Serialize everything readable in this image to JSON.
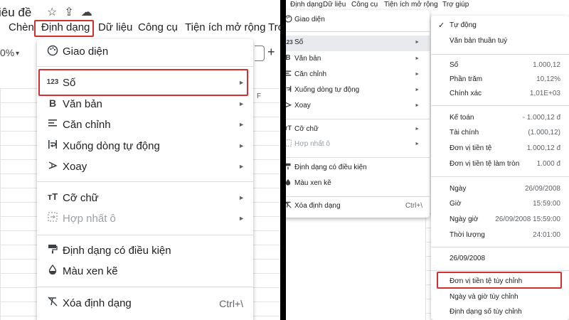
{
  "left": {
    "doc_title": "iêu đề",
    "toolbar_icons": {
      "star": "☆",
      "folder": "⇪",
      "cloud": "☁"
    },
    "menubar": [
      {
        "label": "Chèn"
      },
      {
        "label": "Định dạng"
      },
      {
        "label": "Dữ liệu"
      },
      {
        "label": "Công cụ"
      },
      {
        "label": "Tiện ích mở rộng"
      },
      {
        "label": "Trợ"
      }
    ],
    "zoom": "0%",
    "zoom_arrow": "▾",
    "plus": "+",
    "column_f": "F",
    "menu": {
      "theme": {
        "label": "Giao diện",
        "icon": "palette-icon"
      },
      "number": {
        "label": "Số",
        "icon": "123",
        "arrow": "►"
      },
      "text": {
        "label": "Văn bản",
        "icon": "B",
        "arrow": "►"
      },
      "align": {
        "label": "Căn chỉnh",
        "icon": "align-icon",
        "arrow": "►"
      },
      "wrap": {
        "label": "Xuống dòng tự động",
        "icon": "wrap-icon",
        "arrow": "►"
      },
      "rotate": {
        "label": "Xoay",
        "icon": "rotate-icon",
        "arrow": "►"
      },
      "fontsize": {
        "label": "Cỡ chữ",
        "icon": "тT",
        "arrow": "►"
      },
      "merge": {
        "label": "Hợp nhất ô",
        "icon": "merge-icon",
        "arrow": "►"
      },
      "conditional": {
        "label": "Định dạng có điều kiện",
        "icon": "paint-roller-icon"
      },
      "alternating": {
        "label": "Màu xen kẽ",
        "icon": "droplet-icon"
      },
      "clear": {
        "label": "Xóa định dạng",
        "icon": "clear-format-icon",
        "shortcut": "Ctrl+\\"
      }
    }
  },
  "right": {
    "menubar": [
      {
        "label": "Định dạng"
      },
      {
        "label": "Dữ liệu"
      },
      {
        "label": "Công cụ"
      },
      {
        "label": "Tiện ích mở rộng"
      },
      {
        "label": "Trợ giúp"
      }
    ],
    "menu": {
      "theme": {
        "label": "Giao diện"
      },
      "number": {
        "label": "Số",
        "icon": "123",
        "arrow": "►"
      },
      "text": {
        "label": "Văn bản",
        "icon": "B",
        "arrow": "►"
      },
      "align": {
        "label": "Căn chỉnh",
        "arrow": "►"
      },
      "wrap": {
        "label": "Xuống dòng tự động",
        "arrow": "►"
      },
      "rotate": {
        "label": "Xoay",
        "arrow": "►"
      },
      "fontsize": {
        "label": "Cỡ chữ",
        "icon": "тT",
        "arrow": "►"
      },
      "merge": {
        "label": "Hợp nhất ô",
        "arrow": "►"
      },
      "conditional": {
        "label": "Định dạng có điều kiện"
      },
      "alternating": {
        "label": "Màu xen kẽ"
      },
      "clear": {
        "label": "Xóa định dạng",
        "shortcut": "Ctrl+\\"
      }
    },
    "submenu": {
      "check": "✓",
      "auto": {
        "label": "Tự động"
      },
      "plain": {
        "label": "Văn bản thuần tuý"
      },
      "number": {
        "label": "Số",
        "value": "1.000,12"
      },
      "percent": {
        "label": "Phần trăm",
        "value": "10,12%"
      },
      "scientific": {
        "label": "Chính xác",
        "value": "1,01E+03"
      },
      "accounting": {
        "label": "Kế toán",
        "value": "- 1.000,12 đ"
      },
      "financial": {
        "label": "Tài chính",
        "value": "(1.000,12)"
      },
      "currency": {
        "label": "Đơn vị tiền tệ",
        "value": "1.000,12 đ"
      },
      "currency_rounded": {
        "label": "Đơn vị tiền tệ làm tròn",
        "value": "1.000 đ"
      },
      "date": {
        "label": "Ngày",
        "value": "26/09/2008"
      },
      "time": {
        "label": "Giờ",
        "value": "15:59:00"
      },
      "datetime": {
        "label": "Ngày giờ",
        "value": "26/09/2008 15:59:00"
      },
      "duration": {
        "label": "Thời lượng",
        "value": "24:01:00"
      },
      "custom_date": {
        "label": "26/09/2008"
      },
      "custom_currency": {
        "label": "Đơn vị tiền tệ tùy chỉnh"
      },
      "custom_datetime": {
        "label": "Ngày và giờ tùy chỉnh"
      },
      "custom_number": {
        "label": "Định dạng số tùy chỉnh"
      }
    }
  },
  "colors": {
    "highlight": "#d32f2f",
    "selected_row": "#e8eaed",
    "divider": "#000000"
  }
}
